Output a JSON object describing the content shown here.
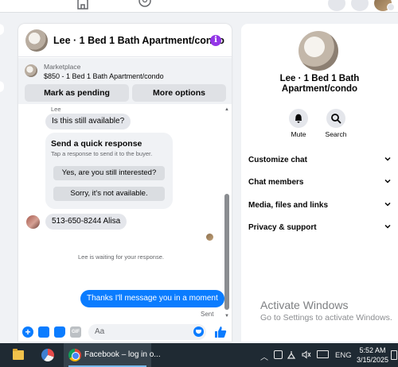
{
  "chat": {
    "title": "Lee · 1 Bed 1 Bath Apartment/condo",
    "info_icon": "info-icon",
    "marketplace": {
      "label": "Marketplace",
      "description": "$850 - 1 Bed 1 Bath Apartment/condo",
      "mark_pending": "Mark as pending",
      "more_options": "More options"
    },
    "messages": {
      "sender": "Lee",
      "first": "Is this still available?",
      "quick_response": {
        "title": "Send a quick response",
        "subtitle": "Tap a response to send it to the buyer.",
        "options": [
          "Yes, are you still interested?",
          "Sorry, it's not available."
        ]
      },
      "phone": "513-650-8244 Alisa",
      "waiting": "Lee is waiting for your response.",
      "outgoing": "Thanks I'll message you in a moment",
      "status": "Sent"
    },
    "composer": {
      "placeholder": "Aa",
      "gif_label": "GIF"
    }
  },
  "details": {
    "name": "Lee · 1 Bed 1 Bath Apartment/condo",
    "actions": [
      "Mute",
      "Search"
    ],
    "sections": [
      "Customize chat",
      "Chat members",
      "Media, files and links",
      "Privacy & support"
    ]
  },
  "watermark": {
    "line1": "Activate Windows",
    "line2": "Go to Settings to activate Windows."
  },
  "taskbar": {
    "active_window": "Facebook – log in o...",
    "language": "ENG",
    "time": "5:52 AM",
    "date": "3/15/2025"
  },
  "colors": {
    "messenger_blue": "#0a7cff",
    "info_purple": "#9336e7",
    "taskbar": "#1f2a33"
  }
}
